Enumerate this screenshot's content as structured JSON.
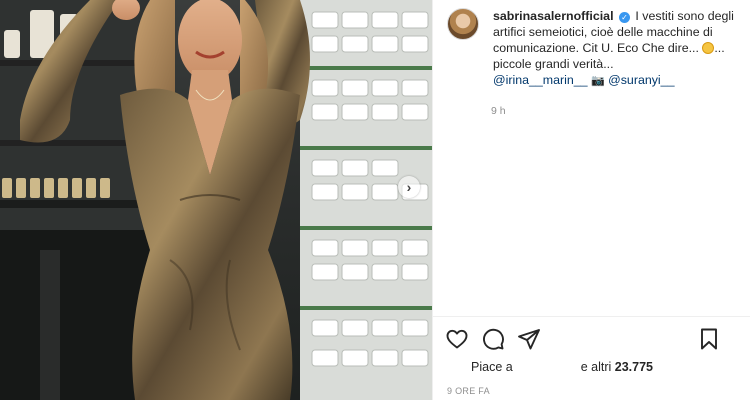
{
  "post": {
    "username": "sabrinasalernofficial",
    "verified_mark": "✓",
    "caption_part1": "I vestiti sono degli artifici semeiotici, cioè delle macchine di comunicazione. Cit U. Eco Che dire... ",
    "caption_part2": "... piccole grandi verità...",
    "mention1": "@irina__marin__",
    "camera": "📷",
    "mention2": "@suranyi__",
    "time_short": "9 h"
  },
  "actions": {
    "like_icon": "heart-icon",
    "comment_icon": "comment-icon",
    "share_icon": "paper-plane-icon",
    "save_icon": "bookmark-icon"
  },
  "likes": {
    "prefix": "Piace a",
    "middle": "e altri",
    "count": "23.775"
  },
  "time_ago": "9 ORE FA",
  "colors": {
    "link": "#00376b",
    "verified": "#3897f0",
    "muted": "#8e8e8e"
  }
}
